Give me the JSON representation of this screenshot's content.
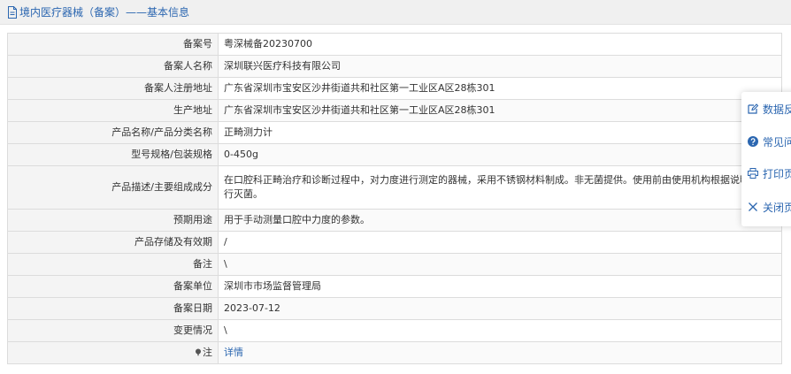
{
  "header": {
    "title": "境内医疗器械（备案）——基本信息"
  },
  "rows": [
    {
      "label": "备案号",
      "value": "粤深械备20230700"
    },
    {
      "label": "备案人名称",
      "value": "深圳联兴医疗科技有限公司"
    },
    {
      "label": "备案人注册地址",
      "value": "广东省深圳市宝安区沙井街道共和社区第一工业区A区28栋301"
    },
    {
      "label": "生产地址",
      "value": "广东省深圳市宝安区沙井街道共和社区第一工业区A区28栋301"
    },
    {
      "label": "产品名称/产品分类名称",
      "value": "正畸测力计"
    },
    {
      "label": "型号规格/包装规格",
      "value": "0-450g"
    },
    {
      "label": "产品描述/主要组成成分",
      "value": "在口腔科正畸治疗和诊断过程中，对力度进行测定的器械，采用不锈钢材料制成。非无菌提供。使用前由使用机构根据说明书进行灭菌。"
    },
    {
      "label": "预期用途",
      "value": "用于手动测量口腔中力度的参数。"
    },
    {
      "label": "产品存储及有效期",
      "value": "/"
    },
    {
      "label": "备注",
      "value": "\\"
    },
    {
      "label": "备案单位",
      "value": "深圳市市场监督管理局"
    },
    {
      "label": "备案日期",
      "value": "2023-07-12"
    },
    {
      "label": "变更情况",
      "value": "\\"
    },
    {
      "label": "注",
      "value": "详情"
    }
  ],
  "float_panel": {
    "feedback": "数据反馈",
    "faq": "常见问题",
    "print": "打印页面",
    "close": "关闭页面"
  },
  "colors": {
    "accent": "#2b66b0",
    "label_bg": "#f4f4f4",
    "border": "#dcdcdc"
  }
}
